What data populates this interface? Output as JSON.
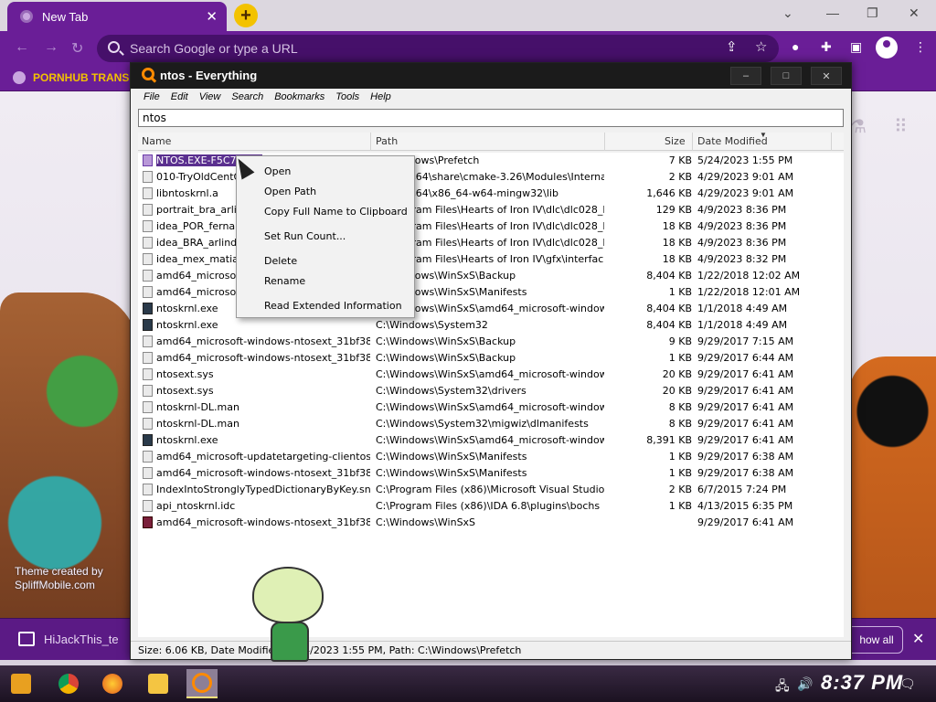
{
  "browser": {
    "tab_title": "New Tab",
    "omnibox_placeholder": "Search Google or type a URL",
    "bookmark_label": "PORNHUB TRANS",
    "theme_credit_line1": "Theme created by",
    "theme_credit_line2": "SpliffMobile.com",
    "notification_text": "HiJackThis_te",
    "show_all_label": "how all"
  },
  "window": {
    "title": "ntos - Everything",
    "menu": [
      "File",
      "Edit",
      "View",
      "Search",
      "Bookmarks",
      "Tools",
      "Help"
    ],
    "search_value": "ntos",
    "columns": {
      "name": "Name",
      "path": "Path",
      "size": "Size",
      "date": "Date Modified"
    },
    "rows": [
      {
        "name": "NTOS.EXE-F5C70",
        "path": "C:\\Windows\\Prefetch",
        "size": "7 KB",
        "date": "5/24/2023 1:55 PM",
        "icon": "sel"
      },
      {
        "name": "010-TryOldCentOS",
        "path": "C:\\msys64\\share\\cmake-3.26\\Modules\\Interna...",
        "size": "2 KB",
        "date": "4/29/2023 9:01 AM",
        "icon": "dll"
      },
      {
        "name": "libntoskrnl.a",
        "path": "C:\\msys64\\x86_64-w64-mingw32\\lib",
        "size": "1,646 KB",
        "date": "4/29/2023 9:01 AM",
        "icon": "dll"
      },
      {
        "name": "portrait_bra_arlindo",
        "path": "C:\\Program Files\\Hearts of Iron IV\\dlc\\dlc028_la_...",
        "size": "129 KB",
        "date": "4/9/2023 8:36 PM",
        "icon": "dll"
      },
      {
        "name": "idea_POR_fernando",
        "path": "C:\\Program Files\\Hearts of Iron IV\\dlc\\dlc028_la_...",
        "size": "18 KB",
        "date": "4/9/2023 8:36 PM",
        "icon": "dll"
      },
      {
        "name": "idea_BRA_arlindo",
        "path": "C:\\Program Files\\Hearts of Iron IV\\dlc\\dlc028_la_...",
        "size": "18 KB",
        "date": "4/9/2023 8:36 PM",
        "icon": "dll"
      },
      {
        "name": "idea_mex_matias",
        "path": "C:\\Program Files\\Hearts of Iron IV\\gfx\\interface\\i...",
        "size": "18 KB",
        "date": "4/9/2023 8:32 PM",
        "icon": "dll"
      },
      {
        "name": "amd64_microsoft-windows-ntosext",
        "path": "C:\\Windows\\WinSxS\\Backup",
        "size": "8,404 KB",
        "date": "1/22/2018 12:02 AM",
        "icon": "dll"
      },
      {
        "name": "amd64_microsoft-windows-ntosext",
        "path": "C:\\Windows\\WinSxS\\Manifests",
        "size": "1 KB",
        "date": "1/22/2018 12:01 AM",
        "icon": "dll"
      },
      {
        "name": "ntoskrnl.exe",
        "path": "C:\\Windows\\WinSxS\\amd64_microsoft-windows-o...",
        "size": "8,404 KB",
        "date": "1/1/2018 4:49 AM",
        "icon": "exe"
      },
      {
        "name": "ntoskrnl.exe",
        "path": "C:\\Windows\\System32",
        "size": "8,404 KB",
        "date": "1/1/2018 4:49 AM",
        "icon": "exe"
      },
      {
        "name": "amd64_microsoft-windows-ntosext_31bf3856...",
        "path": "C:\\Windows\\WinSxS\\Backup",
        "size": "9 KB",
        "date": "9/29/2017 7:15 AM",
        "icon": "dll"
      },
      {
        "name": "amd64_microsoft-windows-ntosext_31bf3856...",
        "path": "C:\\Windows\\WinSxS\\Backup",
        "size": "1 KB",
        "date": "9/29/2017 6:44 AM",
        "icon": "dll"
      },
      {
        "name": "ntosext.sys",
        "path": "C:\\Windows\\WinSxS\\amd64_microsoft-windows-n...",
        "size": "20 KB",
        "date": "9/29/2017 6:41 AM",
        "icon": "dll"
      },
      {
        "name": "ntosext.sys",
        "path": "C:\\Windows\\System32\\drivers",
        "size": "20 KB",
        "date": "9/29/2017 6:41 AM",
        "icon": "dll"
      },
      {
        "name": "ntoskrnl-DL.man",
        "path": "C:\\Windows\\WinSxS\\amd64_microsoft-windows-...",
        "size": "8 KB",
        "date": "9/29/2017 6:41 AM",
        "icon": "dll"
      },
      {
        "name": "ntoskrnl-DL.man",
        "path": "C:\\Windows\\System32\\migwiz\\dlmanifests",
        "size": "8 KB",
        "date": "9/29/2017 6:41 AM",
        "icon": "dll"
      },
      {
        "name": "ntoskrnl.exe",
        "path": "C:\\Windows\\WinSxS\\amd64_microsoft-windows-o...",
        "size": "8,391 KB",
        "date": "9/29/2017 6:41 AM",
        "icon": "exe"
      },
      {
        "name": "amd64_microsoft-updatetargeting-clientos_31...",
        "path": "C:\\Windows\\WinSxS\\Manifests",
        "size": "1 KB",
        "date": "9/29/2017 6:38 AM",
        "icon": "dll"
      },
      {
        "name": "amd64_microsoft-windows-ntosext_31bf3856...",
        "path": "C:\\Windows\\WinSxS\\Manifests",
        "size": "1 KB",
        "date": "9/29/2017 6:38 AM",
        "icon": "dll"
      },
      {
        "name": "IndexIntoStronglyTypedDictionaryByKey.sni...",
        "path": "C:\\Program Files (x86)\\Microsoft Visual Studio 14....",
        "size": "2 KB",
        "date": "6/7/2015 7:24 PM",
        "icon": "dll"
      },
      {
        "name": "api_ntoskrnl.idc",
        "path": "C:\\Program Files (x86)\\IDA 6.8\\plugins\\bochs",
        "size": "1 KB",
        "date": "4/13/2015 6:35 PM",
        "icon": "dll"
      },
      {
        "name": "amd64_microsoft-windows-ntosext_31bf3856...",
        "path": "C:\\Windows\\WinSxS",
        "size": "",
        "date": "9/29/2017 6:41 AM",
        "icon": "red"
      }
    ],
    "status": "Size: 6.06 KB, Date Modified: 5/24/2023 1:55 PM, Path: C:\\Windows\\Prefetch"
  },
  "context_menu": {
    "items": [
      "Open",
      "Open Path",
      "Copy Full Name to Clipboard",
      "Set Run Count...",
      "Delete",
      "Rename",
      "Read Extended Information"
    ]
  },
  "taskbar": {
    "clock": "8:37 PM"
  }
}
